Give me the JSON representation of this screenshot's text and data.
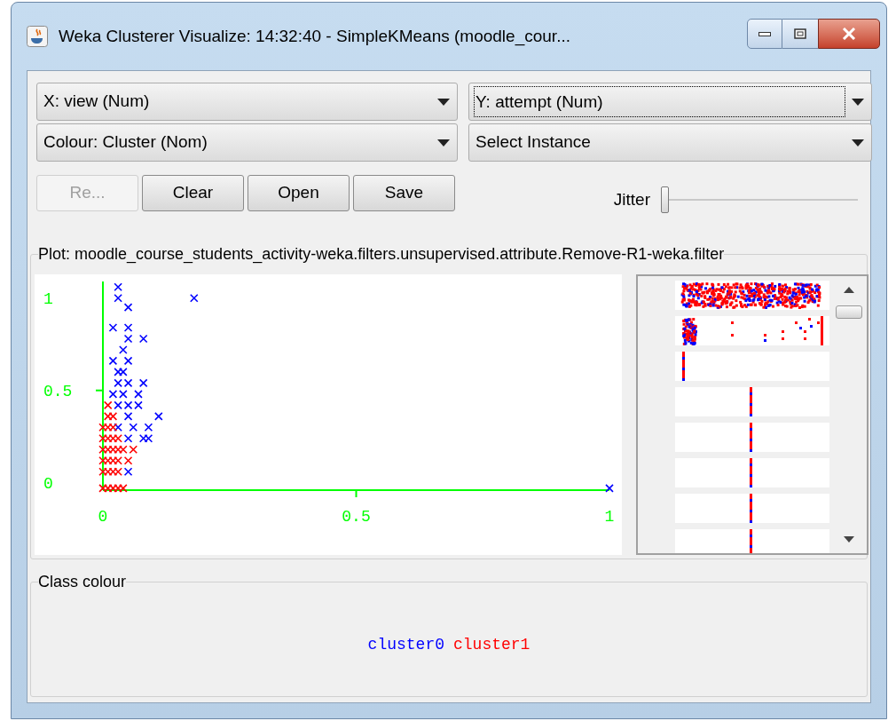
{
  "window": {
    "title": "Weka Clusterer Visualize: 14:32:40 - SimpleKMeans (moodle_cour..."
  },
  "selectors": [
    {
      "label": "X: view (Num)",
      "focused": false
    },
    {
      "label": "Y: attempt (Num)",
      "focused": true
    },
    {
      "label": "Colour: Cluster (Nom)",
      "focused": false
    },
    {
      "label": "Select Instance",
      "focused": false
    }
  ],
  "buttons": [
    {
      "label": "Re...",
      "disabled": true
    },
    {
      "label": "Clear",
      "disabled": false
    },
    {
      "label": "Open",
      "disabled": false
    },
    {
      "label": "Save",
      "disabled": false
    }
  ],
  "jitter": {
    "label": "Jitter",
    "level": 0
  },
  "plot": {
    "title": "Plot: moodle_course_students_activity-weka.filters.unsupervised.attribute.Remove-R1-weka.filter",
    "chart_data": {
      "type": "scatter",
      "xlim": [
        0,
        1
      ],
      "ylim": [
        -0.04,
        1.09
      ],
      "xticks": [
        0,
        0.5,
        1
      ],
      "yticks": [
        0,
        0.5,
        1
      ],
      "x": [
        0.03,
        0.03,
        0.18,
        0.05,
        0.02,
        0.05,
        0.05,
        0.08,
        0.04,
        0.02,
        0.05,
        0.03,
        0.04,
        0.03,
        0.05,
        0.08,
        0.02,
        0.04,
        0.07,
        0.03,
        0.05,
        0.07,
        0.05,
        0.11,
        0.03,
        0.06,
        0.09,
        0.05,
        0.08,
        0.09,
        0.05,
        1.0,
        0.01,
        0.02,
        0.0,
        0.01,
        0.02,
        0.0,
        0.01,
        0.02,
        0.03,
        0.0,
        0.01,
        0.02,
        0.03,
        0.04,
        0.06,
        0.0,
        0.01,
        0.02,
        0.03,
        0.05,
        0.0,
        0.01,
        0.02,
        0.03,
        0.0,
        0.01,
        0.02,
        0.03,
        0.04,
        0.01
      ],
      "series": [
        {
          "color": "#0000ff",
          "values": [
            1.06,
            1.0,
            1.0,
            0.95,
            0.84,
            0.84,
            0.78,
            0.78,
            0.72,
            0.66,
            0.66,
            0.6,
            0.6,
            0.54,
            0.54,
            0.54,
            0.48,
            0.48,
            0.48,
            0.42,
            0.42,
            0.42,
            0.36,
            0.36,
            0.3,
            0.3,
            0.3,
            0.24,
            0.24,
            0.24,
            0.06,
            -0.03,
            null,
            null,
            null,
            null,
            null,
            null,
            null,
            null,
            null,
            null,
            null,
            null,
            null,
            null,
            null,
            null,
            null,
            null,
            null,
            null,
            null,
            null,
            null,
            null,
            null,
            null,
            null,
            null,
            null,
            null
          ]
        },
        {
          "color": "#ff0000",
          "values": [
            null,
            null,
            null,
            null,
            null,
            null,
            null,
            null,
            null,
            null,
            null,
            null,
            null,
            null,
            null,
            null,
            null,
            null,
            null,
            null,
            null,
            null,
            null,
            null,
            null,
            null,
            null,
            null,
            null,
            null,
            null,
            null,
            0.36,
            0.36,
            0.3,
            0.3,
            0.3,
            0.24,
            0.24,
            0.24,
            0.24,
            0.18,
            0.18,
            0.18,
            0.18,
            0.18,
            0.18,
            0.12,
            0.12,
            0.12,
            0.12,
            0.12,
            0.06,
            0.06,
            0.06,
            0.06,
            -0.03,
            -0.03,
            -0.03,
            -0.03,
            -0.03,
            0.42
          ]
        }
      ]
    }
  },
  "class_colour": {
    "title": "Class colour",
    "classes": [
      {
        "name": "cluster0",
        "color": "#0000ff"
      },
      {
        "name": "cluster1",
        "color": "#ff0000"
      }
    ]
  }
}
